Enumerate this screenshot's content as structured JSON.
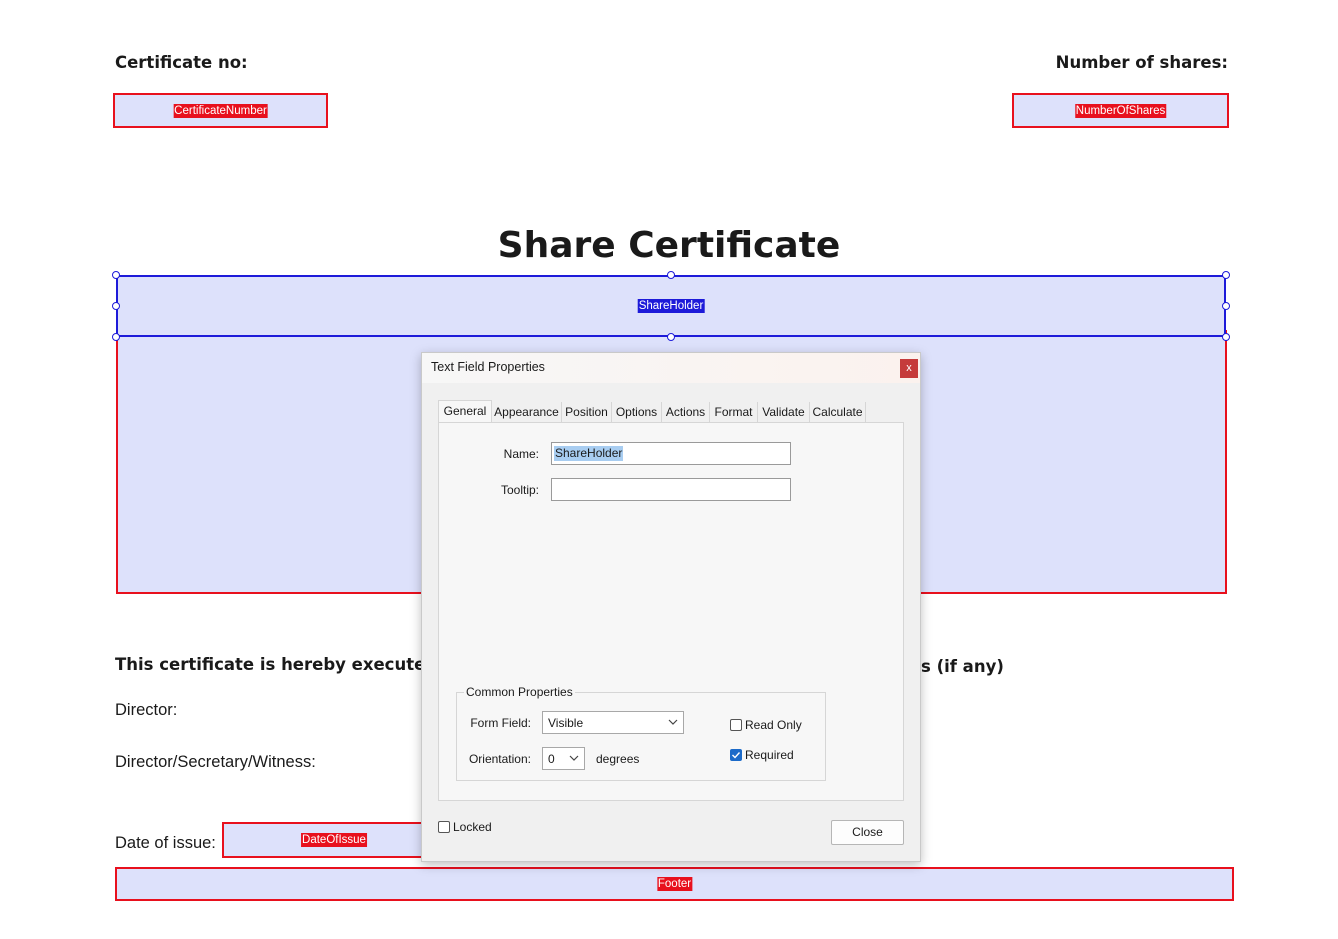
{
  "page": {
    "certificate_no_label": "Certificate no:",
    "number_of_shares_label": "Number of shares:",
    "title": "Share Certificate",
    "executed_text_left": "This certificate is hereby executed b",
    "executed_text_right": "s (if any)",
    "director_label": "Director:",
    "director_secretary_label": "Director/Secretary/Witness:",
    "date_of_issue_label": "Date of issue:"
  },
  "fields": {
    "certificate_number": "CertificateNumber",
    "number_of_shares": "NumberOfShares",
    "share_holder": "ShareHolder",
    "date_of_issue": "DateOfIssue",
    "footer": "Footer"
  },
  "dialog": {
    "title": "Text Field Properties",
    "close_x": "x",
    "tabs": [
      "General",
      "Appearance",
      "Position",
      "Options",
      "Actions",
      "Format",
      "Validate",
      "Calculate"
    ],
    "active_tab": "General",
    "name_label": "Name:",
    "name_value": "ShareHolder",
    "tooltip_label": "Tooltip:",
    "tooltip_value": "",
    "common_properties_title": "Common Properties",
    "form_field_label": "Form Field:",
    "form_field_value": "Visible",
    "orientation_label": "Orientation:",
    "orientation_value": "0",
    "degrees_label": "degrees",
    "read_only_label": "Read Only",
    "read_only_checked": false,
    "required_label": "Required",
    "required_checked": true,
    "locked_label": "Locked",
    "locked_checked": false,
    "close_button": "Close"
  },
  "colors": {
    "field_fill": "#dde1fb",
    "field_border": "#e8101d",
    "selected_border": "#1d1ad9",
    "checkbox_checked": "#1b6ac9"
  }
}
